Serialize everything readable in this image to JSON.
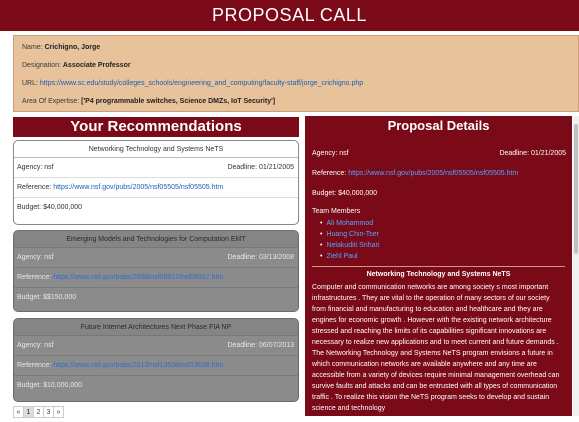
{
  "header": {
    "title": "PROPOSAL CALL"
  },
  "profile": {
    "name_label": "Name:",
    "name": "Crichigno, Jorge",
    "designation_label": "Designation:",
    "designation": "Associate Professor",
    "url_label": "URL:",
    "url": "https://www.sc.edu/study/colleges_schools/engineering_and_computing/faculty-staff/jorge_crichigno.php",
    "expertise_label": "Area Of Expertise:",
    "expertise": "['P4 programmable switches, Science DMZs, IoT Security']"
  },
  "recommendations": {
    "heading": "Your Recommendations",
    "cards": [
      {
        "title": "Networking Technology and Systems NeTS",
        "agency": "Agency: nsf",
        "deadline": "Deadline: 01/21/2005",
        "reference_label": "Reference:",
        "reference": "https://www.nsf.gov/pubs/2005/nsf05505/nsf05505.htm",
        "budget": "Budget: $40,000,000"
      },
      {
        "title": "Emerging Models and Technologies for Computation EMT",
        "agency": "Agency: nsf",
        "deadline": "Deadline: 03/13/2008",
        "reference_label": "Reference:",
        "reference": "https://www.nsf.gov/pubs/2008/nsf08517/nsf08517.htm",
        "budget": "Budget: $$150,000"
      },
      {
        "title": "Future Internet Architectures Next Phase FIA NP",
        "agency": "Agency: nsf",
        "deadline": "Deadline: 06/07/2013",
        "reference_label": "Reference:",
        "reference": "https://www.nsf.gov/pubs/2013/nsf13538/nsf13538.htm",
        "budget": "Budget: $10,000,000"
      }
    ],
    "pagination": {
      "prev": "«",
      "pages": [
        "1",
        "2",
        "3"
      ],
      "next": "»",
      "current": "1"
    }
  },
  "details": {
    "heading": "Proposal Details",
    "agency": "Agency: nsf",
    "deadline": "Deadline: 01/21/2005",
    "reference_label": "Reference:",
    "reference": "https://www.nsf.gov/pubs/2005/nsf05505/nsf05505.htm",
    "budget": "Budget: $40,000,000",
    "team_label": "Team Members",
    "team": [
      "Ali Mohammod",
      "Huang Chin-Tser",
      "Nelakuditi Srihari",
      "Ziehl Paul"
    ],
    "program_title": "Networking Technology and Systems NeTS",
    "description": "Computer and communication networks are among society s most important infrastructures . They are vital to the operation of many sectors of our society from financial and manufacturing to education and healthcare and they are engines for economic growth . However with the existing network architecture stressed and reaching the limits of its capabilities significant innovations are necessary to realize new applications and to meet current and future demands . The Networking Technology and Systems NeTS program envisions a future in which communication networks are available anywhere and any time are accessible from a variety of devices require minimal management overhead can survive faults and attacks and can be entrusted with all types of communication traffic . To realize this vision the NeTS program seeks to develop and sustain science and technology"
  }
}
